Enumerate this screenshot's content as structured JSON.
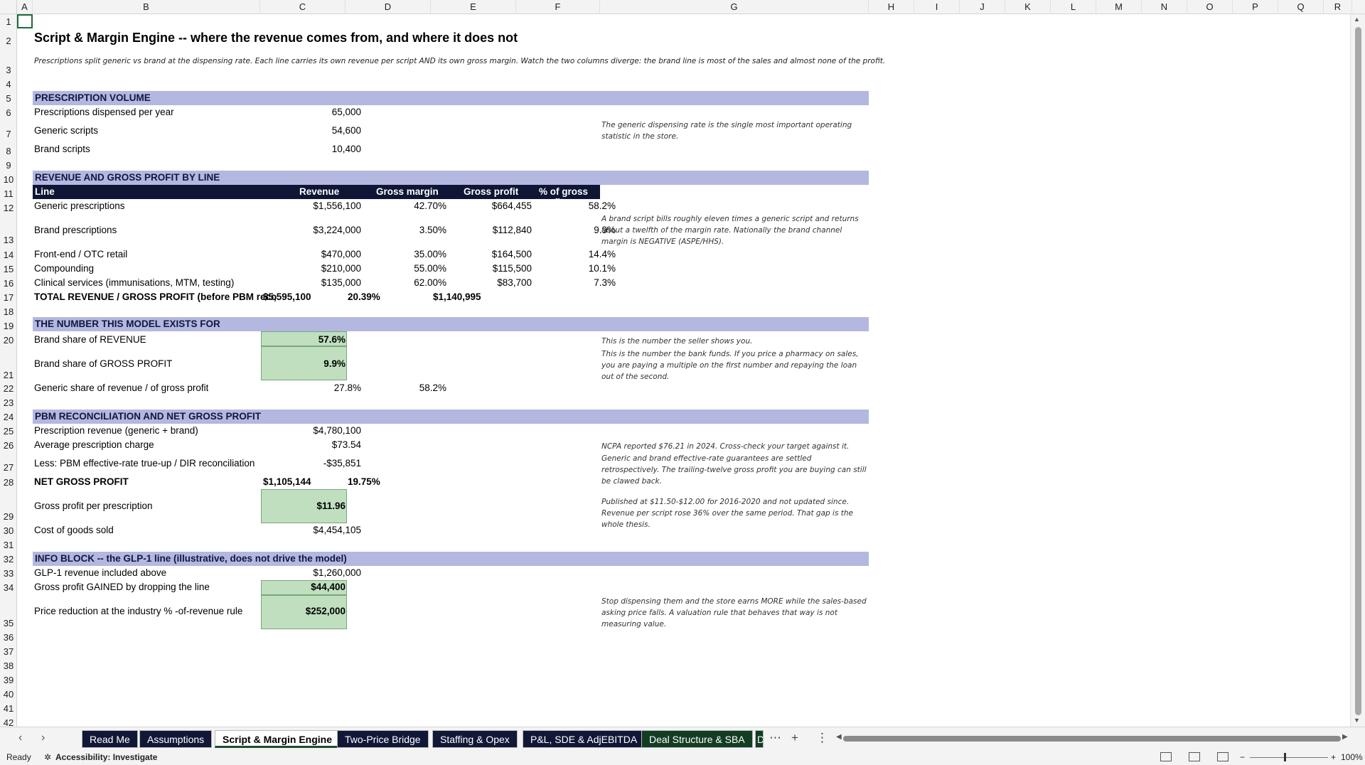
{
  "columns": [
    "A",
    "B",
    "C",
    "D",
    "E",
    "F",
    "G",
    "H",
    "I",
    "J",
    "K",
    "L",
    "M",
    "N",
    "O",
    "P",
    "Q",
    "R"
  ],
  "rows": [
    "1",
    "2",
    "3",
    "4",
    "5",
    "6",
    "7",
    "8",
    "9",
    "10",
    "11",
    "12",
    "13",
    "14",
    "15",
    "16",
    "17",
    "18",
    "19",
    "20",
    "21",
    "22",
    "23",
    "24",
    "25",
    "26",
    "27",
    "28",
    "29",
    "30",
    "31",
    "32",
    "33",
    "34",
    "35",
    "36",
    "37",
    "38",
    "39",
    "40",
    "41",
    "42"
  ],
  "title": "Script & Margin Engine -- where the revenue comes from, and where it does not",
  "subtitle": "Prescriptions split generic vs brand at the dispensing rate. Each line carries its own revenue per script AND its own gross margin. Watch the two columns diverge: the brand line is most of the sales and almost none of the profit.",
  "sections": {
    "volume": "PRESCRIPTION VOLUME",
    "revenue": "REVENUE AND GROSS PROFIT BY LINE",
    "number": "THE NUMBER THIS MODEL EXISTS FOR",
    "pbm": "PBM RECONCILIATION AND NET GROSS PROFIT",
    "glp": "INFO BLOCK -- the GLP-1 line (illustrative, does not drive the model)"
  },
  "volume": {
    "rows": [
      {
        "label": "Prescriptions dispensed per year",
        "value": "65,000"
      },
      {
        "label": "Generic scripts",
        "value": "54,600"
      },
      {
        "label": "Brand scripts",
        "value": "10,400"
      }
    ],
    "note": "The generic dispensing rate is the single most important operating statistic in the store."
  },
  "revenue_table": {
    "headers": [
      "Line",
      "Revenue",
      "Gross margin",
      "Gross profit",
      "% of gross profit"
    ],
    "rows": [
      {
        "line": "Generic prescriptions",
        "revenue": "$1,556,100",
        "margin": "42.70%",
        "profit": "$664,455",
        "share": "58.2%"
      },
      {
        "line": "Brand prescriptions",
        "revenue": "$3,224,000",
        "margin": "3.50%",
        "profit": "$112,840",
        "share": "9.9%"
      },
      {
        "line": "Front-end / OTC retail",
        "revenue": "$470,000",
        "margin": "35.00%",
        "profit": "$164,500",
        "share": "14.4%"
      },
      {
        "line": "Compounding",
        "revenue": "$210,000",
        "margin": "55.00%",
        "profit": "$115,500",
        "share": "10.1%"
      },
      {
        "line": "Clinical services (immunisations, MTM, testing)",
        "revenue": "$135,000",
        "margin": "62.00%",
        "profit": "$83,700",
        "share": "7.3%"
      }
    ],
    "total": {
      "label": "TOTAL REVENUE / GROSS PROFIT (before PBM recon",
      "revenue": "$5,595,100",
      "margin": "20.39%",
      "profit": "$1,140,995"
    },
    "note": "A brand script bills roughly eleven times a generic script and returns about a twelfth of the margin rate. Nationally the brand channel margin is NEGATIVE (ASPE/HHS)."
  },
  "number": {
    "brand_rev_label": "Brand share of REVENUE",
    "brand_rev": "57.6%",
    "brand_gp_label": "Brand share of GROSS PROFIT",
    "brand_gp": "9.9%",
    "generic_label": "Generic share of revenue / of gross profit",
    "generic_rev": "27.8%",
    "generic_gp": "58.2%",
    "note1": "This is the number the seller shows you.",
    "note2": "This is the number the bank funds. If you price a pharmacy on sales, you are paying a multiple on the first number and repaying the loan out of the second."
  },
  "pbm": {
    "rx_rev_label": "Prescription revenue (generic + brand)",
    "rx_rev": "$4,780,100",
    "avg_label": "Average prescription charge",
    "avg": "$73.54",
    "less_label": "Less: PBM effective-rate true-up / DIR reconciliation",
    "less": "-$35,851",
    "net_label": "NET GROSS PROFIT",
    "net": "$1,105,144",
    "net_pct": "19.75%",
    "gpp_label": "Gross profit per prescription",
    "gpp": "$11.96",
    "cogs_label": "Cost of goods sold",
    "cogs": "$4,454,105",
    "note1": "NCPA reported $76.21 in 2024. Cross-check your target against it.",
    "note2": "Generic and brand effective-rate guarantees are settled retrospectively. The trailing-twelve gross profit you are buying can still be clawed back.",
    "note3": "Published at $11.50-$12.00 for 2016-2020 and not updated since. Revenue per script rose 36% over the same period. That gap is the whole thesis."
  },
  "glp": {
    "rev_label": "GLP-1 revenue included above",
    "rev": "$1,260,000",
    "gained_label": "Gross profit GAINED by dropping the line",
    "gained": "$44,400",
    "reduction_label": "Price reduction at the industry % -of-revenue rule",
    "reduction": "$252,000",
    "note": "Stop dispensing them and the store earns MORE while the sales-based asking price falls. A valuation rule that behaves that way is not measuring value."
  },
  "tabs": [
    "Read Me",
    "Assumptions",
    "Script & Margin Engine",
    "Two-Price Bridge",
    "Staffing & Opex",
    "P&L, SDE & AdjEBITDA",
    "Deal Structure & SBA",
    "D"
  ],
  "status": {
    "ready": "Ready",
    "accessibility": "Accessibility: Investigate",
    "zoom": "100%"
  },
  "colors": {
    "band": "#b4b7df",
    "header_dark": "#0f1535",
    "highlight_green": "#bfdfbf",
    "tab_dark": "#111837",
    "tab_green": "#123d23"
  }
}
